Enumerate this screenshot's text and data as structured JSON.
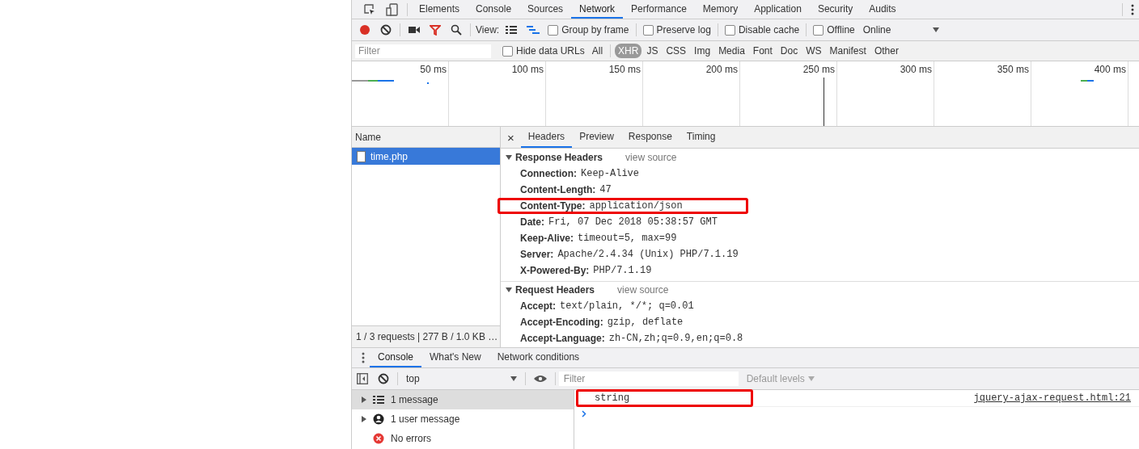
{
  "main_tabs": [
    {
      "label": "Elements",
      "selected": false
    },
    {
      "label": "Console",
      "selected": false
    },
    {
      "label": "Sources",
      "selected": false
    },
    {
      "label": "Network",
      "selected": true
    },
    {
      "label": "Performance",
      "selected": false
    },
    {
      "label": "Memory",
      "selected": false
    },
    {
      "label": "Application",
      "selected": false
    },
    {
      "label": "Security",
      "selected": false
    },
    {
      "label": "Audits",
      "selected": false
    }
  ],
  "toolbar": {
    "recording": true,
    "view_label": "View:",
    "checkboxes": [
      {
        "label": "Group by frame",
        "checked": false
      },
      {
        "label": "Preserve log",
        "checked": false
      },
      {
        "label": "Disable cache",
        "checked": false
      },
      {
        "label": "Offline",
        "checked": false
      }
    ],
    "throttling": "Online"
  },
  "filter": {
    "placeholder": "Filter",
    "hide_data_urls": {
      "label": "Hide data URLs",
      "checked": false
    },
    "types": [
      {
        "label": "All",
        "selected": false
      },
      {
        "label": "XHR",
        "selected": true
      },
      {
        "label": "JS",
        "selected": false
      },
      {
        "label": "CSS",
        "selected": false
      },
      {
        "label": "Img",
        "selected": false
      },
      {
        "label": "Media",
        "selected": false
      },
      {
        "label": "Font",
        "selected": false
      },
      {
        "label": "Doc",
        "selected": false
      },
      {
        "label": "WS",
        "selected": false
      },
      {
        "label": "Manifest",
        "selected": false
      },
      {
        "label": "Other",
        "selected": false
      }
    ]
  },
  "overview": {
    "ticks": [
      "50 ms",
      "100 ms",
      "150 ms",
      "200 ms",
      "250 ms",
      "300 ms",
      "350 ms",
      "400 ms"
    ]
  },
  "requests": {
    "column": "Name",
    "items": [
      {
        "name": "time.php",
        "selected": true
      }
    ],
    "summary": "1 / 3 requests | 277 B / 1.0 KB …"
  },
  "details": {
    "close": "×",
    "tabs": [
      {
        "label": "Headers",
        "selected": true
      },
      {
        "label": "Preview",
        "selected": false
      },
      {
        "label": "Response",
        "selected": false
      },
      {
        "label": "Timing",
        "selected": false
      }
    ],
    "sections": [
      {
        "title": "Response Headers",
        "view_source": "view source",
        "expanded": true,
        "headers": [
          {
            "name": "Connection:",
            "value": "Keep-Alive",
            "highlighted": false
          },
          {
            "name": "Content-Length:",
            "value": "47",
            "highlighted": false
          },
          {
            "name": "Content-Type:",
            "value": "application/json",
            "highlighted": true
          },
          {
            "name": "Date:",
            "value": "Fri, 07 Dec 2018 05:38:57 GMT",
            "highlighted": false
          },
          {
            "name": "Keep-Alive:",
            "value": "timeout=5, max=99",
            "highlighted": false
          },
          {
            "name": "Server:",
            "value": "Apache/2.4.34 (Unix) PHP/7.1.19",
            "highlighted": false
          },
          {
            "name": "X-Powered-By:",
            "value": "PHP/7.1.19",
            "highlighted": false
          }
        ]
      },
      {
        "title": "Request Headers",
        "view_source": "view source",
        "expanded": true,
        "headers": [
          {
            "name": "Accept:",
            "value": "text/plain, */*; q=0.01",
            "highlighted": false
          },
          {
            "name": "Accept-Encoding:",
            "value": "gzip, deflate",
            "highlighted": false
          },
          {
            "name": "Accept-Language:",
            "value": "zh-CN,zh;q=0.9,en;q=0.8",
            "highlighted": false
          }
        ]
      }
    ]
  },
  "drawer": {
    "tabs": [
      {
        "label": "Console",
        "selected": true
      },
      {
        "label": "What's New",
        "selected": false
      },
      {
        "label": "Network conditions",
        "selected": false
      }
    ],
    "context": "top",
    "filter_placeholder": "Filter",
    "levels": "Default levels",
    "sidebar": [
      {
        "kind": "messages",
        "label": "1 message",
        "selected": true
      },
      {
        "kind": "user",
        "label": "1 user message",
        "selected": false
      },
      {
        "kind": "errors",
        "label": "No errors",
        "selected": false
      }
    ],
    "messages": [
      {
        "text": "string",
        "source": "jquery-ajax-request.html:21",
        "highlighted": true
      }
    ]
  }
}
